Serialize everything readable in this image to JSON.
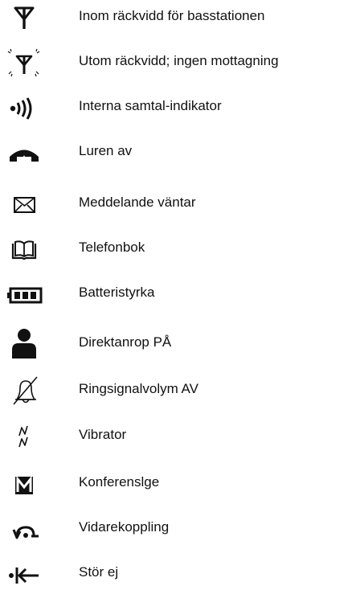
{
  "legend": {
    "items": [
      {
        "icon": "antenna-in-range-icon",
        "label": "Inom räckvidd för basstationen"
      },
      {
        "icon": "antenna-out-of-range-icon",
        "label": "Utom räckvidd; ingen mottagning"
      },
      {
        "icon": "internal-call-icon",
        "label": "Interna samtal-indikator"
      },
      {
        "icon": "handset-off-hook-icon",
        "label": "Luren av"
      },
      {
        "icon": "envelope-icon",
        "label": "Meddelande väntar"
      },
      {
        "icon": "phonebook-icon",
        "label": "Telefonbok"
      },
      {
        "icon": "battery-icon",
        "label": "Batteristyrka"
      },
      {
        "icon": "person-icon",
        "label": "Direktanrop PÅ"
      },
      {
        "icon": "bell-off-icon",
        "label": "Ringsignalvolym AV"
      },
      {
        "icon": "vibrator-icon",
        "label": "Vibrator"
      },
      {
        "icon": "conference-icon",
        "label": "Konferenslge"
      },
      {
        "icon": "call-forward-icon",
        "label": "Vidarekoppling"
      },
      {
        "icon": "do-not-disturb-icon",
        "label": "Stör ej"
      }
    ]
  }
}
